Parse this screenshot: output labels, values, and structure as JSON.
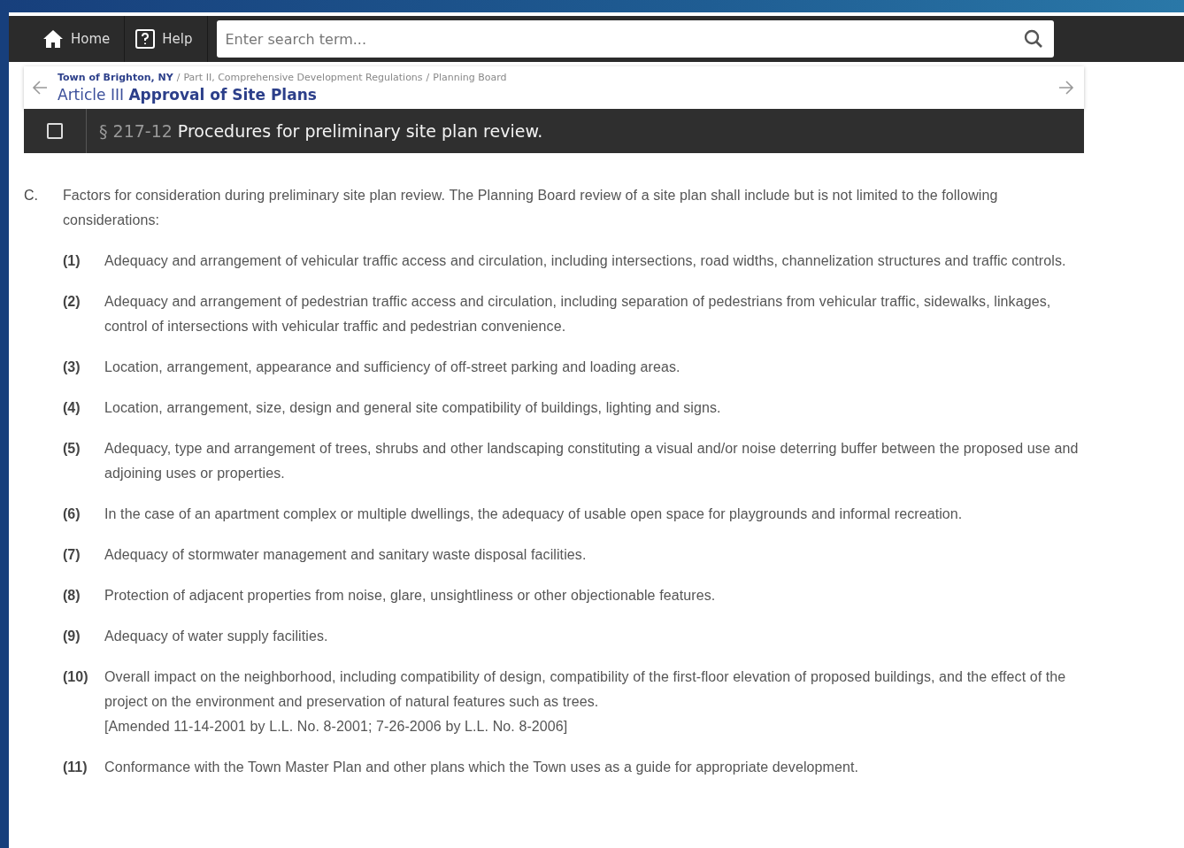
{
  "toolbar": {
    "home_label": "Home",
    "help_label": "Help",
    "search": {
      "placeholder": "Enter search term..."
    }
  },
  "breadcrumb": {
    "separator": "/",
    "links": [
      "Town of Brighton, NY",
      "Part II, Comprehensive Development Regulations",
      "Planning Board"
    ],
    "title_prefix": "Article III",
    "title": "Approval of Site Plans"
  },
  "section_bar": {
    "checked": false,
    "number": "§ 217-12",
    "title": "Procedures for preliminary site plan review."
  },
  "paragraph": {
    "marker": "C.",
    "text": "Factors for consideration during preliminary site plan review. The Planning Board review of a site plan shall include but is not limited to the following considerations:"
  },
  "items": [
    {
      "marker": "(1)",
      "text": "Adequacy and arrangement of vehicular traffic access and circulation, including intersections, road widths, channelization structures and traffic controls."
    },
    {
      "marker": "(2)",
      "text": "Adequacy and arrangement of pedestrian traffic access and circulation, including separation of pedestrians from vehicular traffic, sidewalks, linkages, control of intersections with vehicular traffic and pedestrian convenience."
    },
    {
      "marker": "(3)",
      "text": "Location, arrangement, appearance and sufficiency of off-street parking and loading areas."
    },
    {
      "marker": "(4)",
      "text": "Location, arrangement, size, design and general site compatibility of buildings, lighting and signs."
    },
    {
      "marker": "(5)",
      "text": "Adequacy, type and arrangement of trees, shrubs and other landscaping constituting a visual and/or noise deterring buffer between the proposed use and adjoining uses or properties."
    },
    {
      "marker": "(6)",
      "text": "In the case of an apartment complex or multiple dwellings, the adequacy of usable open space for playgrounds and informal recreation."
    },
    {
      "marker": "(7)",
      "text": "Adequacy of stormwater management and sanitary waste disposal facilities."
    },
    {
      "marker": "(8)",
      "text": "Protection of adjacent properties from noise, glare, unsightliness or other objectionable features."
    },
    {
      "marker": "(9)",
      "text": "Adequacy of water supply facilities."
    },
    {
      "marker": "(10)",
      "text": "Overall impact on the neighborhood, including compatibility of design, compatibility of the first-floor elevation of proposed buildings, and the effect of the project on the environment and preservation of natural features such as trees.",
      "note": "[Amended 11-14-2001 by L.L. No. 8-2001; 7-26-2006 by L.L. No. 8-2006]"
    },
    {
      "marker": "(11)",
      "text": "Conformance with the Town Master Plan and other plans which the Town uses as a guide for appropriate development."
    }
  ]
}
